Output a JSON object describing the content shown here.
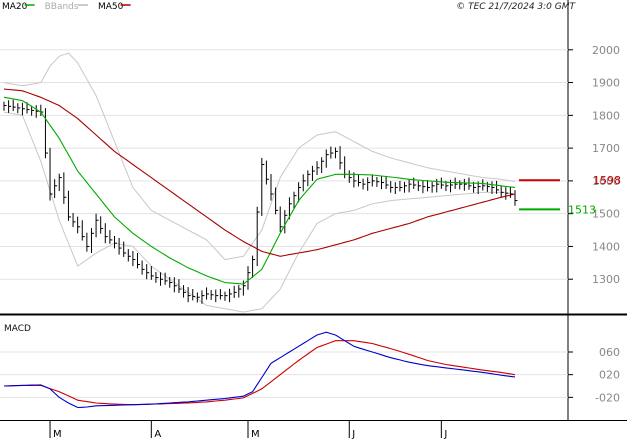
{
  "chart_data": [
    {
      "type": "line",
      "panel": "price",
      "legend": [
        {
          "name": "MA20",
          "color": "#00aa00"
        },
        {
          "name": "BBands",
          "color": "#bbbbbb"
        },
        {
          "name": "MA50",
          "color": "#aa0000"
        }
      ],
      "copyright": "© TEC 21/7/2024 3:0 GMT",
      "ylim": [
        1200,
        2100
      ],
      "y_ticks": [
        1300,
        1400,
        1500,
        1600,
        1700,
        1800,
        1900,
        2000
      ],
      "y_tick_labels": [
        "1300",
        "1400",
        "1500",
        "1600",
        "1700",
        "1800",
        "1900",
        "2000"
      ],
      "grid": true,
      "x_labels": [
        "M",
        "A",
        "M",
        "J",
        "J"
      ],
      "x_label_positions": [
        10,
        32,
        53,
        75,
        95
      ],
      "bar_count": 112,
      "markers": [
        {
          "label": "1598",
          "value": 1602,
          "color": "#cc0000"
        },
        {
          "label": "1513",
          "value": 1513,
          "color": "#00aa00"
        }
      ],
      "series": [
        {
          "name": "Close",
          "x": [
            0,
            4,
            8,
            10,
            12,
            14,
            16,
            18,
            20,
            22,
            24,
            26,
            28,
            30,
            32,
            34,
            36,
            38,
            40,
            42,
            44,
            46,
            48,
            50,
            52,
            54,
            56,
            58,
            60,
            62,
            64,
            66,
            68,
            70,
            72,
            74,
            76,
            78,
            80,
            82,
            84,
            86,
            88,
            90,
            92,
            94,
            96,
            98,
            100,
            102,
            104,
            106,
            108,
            110,
            111
          ],
          "values": [
            1830,
            1820,
            1810,
            1560,
            1610,
            1490,
            1460,
            1400,
            1480,
            1430,
            1410,
            1380,
            1360,
            1330,
            1310,
            1300,
            1290,
            1270,
            1250,
            1245,
            1255,
            1250,
            1250,
            1260,
            1280,
            1360,
            1650,
            1560,
            1460,
            1530,
            1580,
            1620,
            1640,
            1680,
            1690,
            1620,
            1600,
            1590,
            1600,
            1595,
            1580,
            1580,
            1590,
            1585,
            1580,
            1590,
            1585,
            1590,
            1590,
            1580,
            1585,
            1580,
            1565,
            1560,
            1540
          ]
        },
        {
          "name": "MA20",
          "x": [
            0,
            4,
            8,
            12,
            16,
            20,
            24,
            28,
            32,
            36,
            40,
            44,
            48,
            52,
            56,
            60,
            64,
            68,
            72,
            76,
            80,
            84,
            88,
            92,
            96,
            100,
            104,
            108,
            111
          ],
          "values": [
            1855,
            1845,
            1810,
            1730,
            1630,
            1560,
            1490,
            1440,
            1400,
            1365,
            1335,
            1310,
            1290,
            1285,
            1330,
            1440,
            1540,
            1605,
            1620,
            1620,
            1618,
            1612,
            1605,
            1600,
            1596,
            1594,
            1592,
            1585,
            1580
          ]
        },
        {
          "name": "MA50",
          "x": [
            0,
            4,
            8,
            12,
            16,
            20,
            24,
            28,
            32,
            36,
            40,
            44,
            48,
            52,
            56,
            60,
            64,
            68,
            72,
            76,
            80,
            84,
            88,
            92,
            96,
            100,
            104,
            108,
            111
          ],
          "values": [
            1880,
            1875,
            1855,
            1830,
            1790,
            1740,
            1690,
            1650,
            1610,
            1570,
            1530,
            1490,
            1450,
            1415,
            1385,
            1370,
            1380,
            1390,
            1405,
            1420,
            1440,
            1455,
            1470,
            1490,
            1505,
            1520,
            1535,
            1550,
            1560
          ]
        },
        {
          "name": "BBands upper",
          "x": [
            0,
            4,
            8,
            10,
            12,
            14,
            16,
            20,
            24,
            28,
            32,
            36,
            40,
            44,
            48,
            52,
            56,
            60,
            64,
            68,
            72,
            76,
            80,
            84,
            88,
            92,
            96,
            100,
            104,
            108,
            111
          ],
          "values": [
            1900,
            1890,
            1900,
            1950,
            1980,
            1990,
            1960,
            1860,
            1720,
            1580,
            1510,
            1480,
            1450,
            1420,
            1360,
            1370,
            1450,
            1610,
            1700,
            1740,
            1750,
            1720,
            1690,
            1670,
            1655,
            1640,
            1630,
            1620,
            1610,
            1605,
            1598
          ]
        },
        {
          "name": "BBands lower",
          "x": [
            0,
            4,
            8,
            12,
            16,
            20,
            24,
            28,
            32,
            36,
            40,
            44,
            48,
            52,
            56,
            60,
            64,
            68,
            72,
            76,
            80,
            84,
            88,
            92,
            96,
            100,
            104,
            108,
            111
          ],
          "values": [
            1810,
            1800,
            1660,
            1480,
            1340,
            1380,
            1410,
            1400,
            1340,
            1300,
            1260,
            1220,
            1210,
            1200,
            1210,
            1270,
            1380,
            1470,
            1500,
            1510,
            1530,
            1540,
            1545,
            1550,
            1555,
            1560,
            1565,
            1565,
            1560
          ]
        }
      ]
    },
    {
      "type": "line",
      "panel": "macd",
      "title": "MACD",
      "ylim": [
        -60,
        120
      ],
      "y_ticks": [
        -20,
        20,
        60
      ],
      "y_tick_labels": [
        "-020",
        "020",
        "060"
      ],
      "grid": true,
      "series": [
        {
          "name": "MACD",
          "x": [
            0,
            4,
            8,
            10,
            12,
            14,
            16,
            18,
            20,
            24,
            28,
            32,
            36,
            40,
            44,
            48,
            52,
            54,
            56,
            58,
            60,
            62,
            64,
            66,
            68,
            70,
            72,
            74,
            76,
            80,
            84,
            88,
            92,
            96,
            100,
            104,
            108,
            111
          ],
          "values": [
            0,
            1,
            2,
            -5,
            -20,
            -30,
            -38,
            -37,
            -35,
            -34,
            -33,
            -32,
            -30,
            -28,
            -25,
            -22,
            -18,
            -10,
            15,
            40,
            50,
            60,
            70,
            80,
            90,
            95,
            90,
            80,
            70,
            60,
            50,
            42,
            36,
            32,
            28,
            24,
            19,
            16
          ]
        },
        {
          "name": "Signal",
          "x": [
            0,
            4,
            8,
            12,
            16,
            20,
            24,
            28,
            32,
            36,
            40,
            44,
            48,
            52,
            56,
            60,
            64,
            68,
            72,
            76,
            80,
            84,
            88,
            92,
            96,
            100,
            104,
            108,
            111
          ],
          "values": [
            0,
            1,
            1,
            -10,
            -25,
            -30,
            -32,
            -33,
            -32,
            -31,
            -30,
            -28,
            -25,
            -21,
            -5,
            20,
            45,
            68,
            80,
            80,
            75,
            66,
            56,
            45,
            38,
            33,
            28,
            24,
            20
          ]
        }
      ]
    }
  ]
}
